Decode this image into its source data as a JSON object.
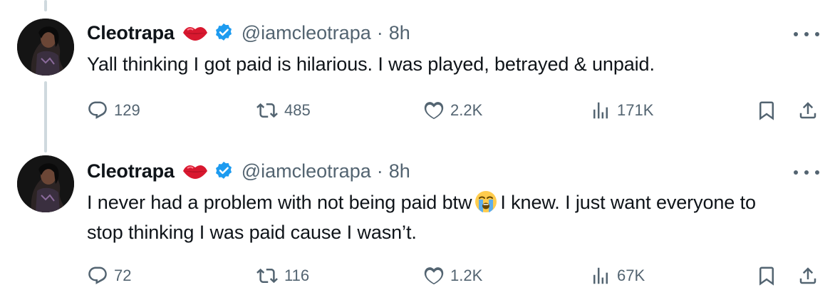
{
  "tweets": [
    {
      "name": "Cleotrapa",
      "handle": "@iamcleotrapa",
      "separator": "·",
      "time": "8h",
      "text": "Yall thinking I got paid is hilarious. I was played, betrayed & unpaid.",
      "text_after": "",
      "replies": "129",
      "reposts": "485",
      "likes": "2.2K",
      "views": "171K"
    },
    {
      "name": "Cleotrapa",
      "handle": "@iamcleotrapa",
      "separator": "·",
      "time": "8h",
      "text": "I never had a problem with not being paid btw",
      "text_after": "I knew. I just want everyone to stop thinking I was paid cause I wasn’t.",
      "replies": "72",
      "reposts": "116",
      "likes": "1.2K",
      "views": "67K"
    }
  ],
  "icons": {
    "emoji_badge": "lips-emoji",
    "verified": "verified-badge-icon",
    "inline_emoji": "loudly-crying-face-emoji",
    "reply": "reply-icon",
    "repost": "repost-icon",
    "like": "heart-icon",
    "views": "views-chart-icon",
    "bookmark": "bookmark-icon",
    "share": "share-icon",
    "more": "more-options-icon"
  },
  "colors": {
    "text": "#0f1419",
    "secondary": "#536471",
    "verified": "#1d9bf0",
    "thread_line": "#cfd9de"
  }
}
